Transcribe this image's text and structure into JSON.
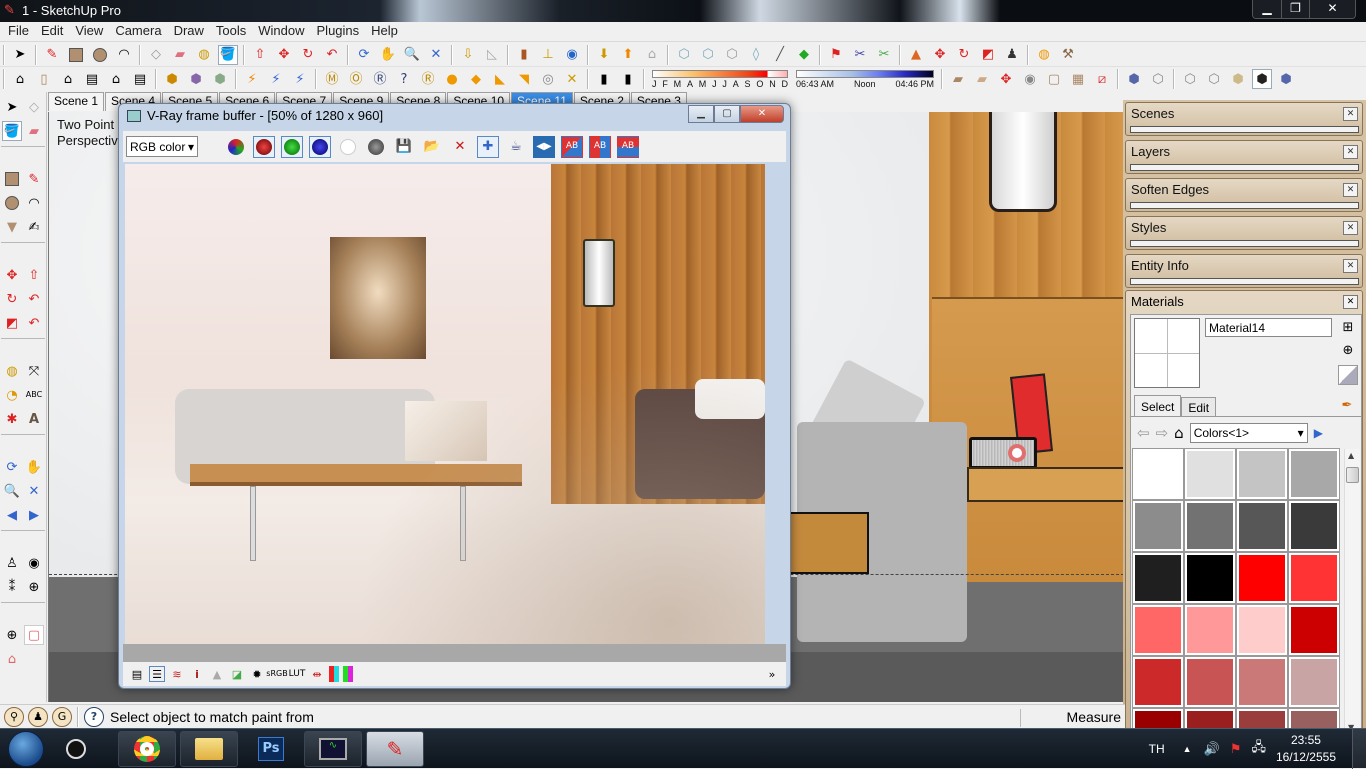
{
  "window": {
    "title": "1 - SketchUp Pro",
    "controls": [
      "minimize",
      "restore",
      "close"
    ]
  },
  "menu": [
    "File",
    "Edit",
    "View",
    "Camera",
    "Draw",
    "Tools",
    "Window",
    "Plugins",
    "Help"
  ],
  "toolbar1": {
    "icons": [
      "select-icon",
      "line-icon",
      "rectangle-icon",
      "circle-icon",
      "arc-icon",
      "make-component-icon",
      "eraser-icon",
      "tape-measure-icon",
      "paint-bucket-icon",
      "push-pull-icon",
      "move-icon",
      "rotate-icon",
      "follow-me-icon",
      "orbit-icon",
      "pan-icon",
      "zoom-icon",
      "zoom-extents-icon",
      "get-models-icon",
      "share-model-icon",
      "add-location-icon",
      "toggle-terrain-icon",
      "google-earth-icon",
      "get-photo-texture-icon",
      "share-component-icon",
      "component-icon",
      "xray-icon",
      "back-edges-icon",
      "wireframe-icon",
      "hidden-line-icon",
      "shaded-icon",
      "shaded-textures-icon",
      "sandbox-from-contours-icon",
      "sandbox-from-scratch-icon",
      "smoove-icon",
      "stamp-icon",
      "drape-icon",
      "add-detail-icon",
      "flip-edge-icon",
      "sun-icon",
      "tools-icon"
    ]
  },
  "toolbar2": {
    "icons": [
      "iso-view-icon",
      "top-view-icon",
      "front-view-icon",
      "right-view-icon",
      "back-view-icon",
      "left-view-icon",
      "outer-shell-icon",
      "intersect-icon",
      "union-icon",
      "section-plane-icon",
      "display-section-icon",
      "display-cuts-icon",
      "vray-material-editor-icon",
      "vray-options-icon",
      "vray-render-icon",
      "vray-help-icon",
      "vray-rt-icon",
      "omni-light-icon",
      "rect-light-icon",
      "spot-light-icon",
      "ies-light-icon",
      "dome-light-icon",
      "sphere-light-icon",
      "mesh-light-icon",
      "model-info-icon",
      "entity-info-icon"
    ],
    "shadow_months": [
      "J",
      "F",
      "M",
      "A",
      "M",
      "J",
      "J",
      "A",
      "S",
      "O",
      "N",
      "D"
    ],
    "shadow_month_value": "O",
    "shadow_times": [
      "06:43 AM",
      "Noon",
      "04:46 PM"
    ],
    "style_icons": [
      "xray-face-icon",
      "wire-face-icon",
      "hidden-line-face-icon",
      "shaded-face-icon",
      "texture-face-icon",
      "monochrome-face-icon",
      "section-face-icon",
      "back-edges-face-icon",
      "face-style-icon"
    ]
  },
  "left_toolbar": [
    "select-icon",
    "make-component-icon",
    "paint-bucket-icon",
    "eraser-icon",
    "rectangle-icon",
    "line-icon",
    "circle-icon",
    "arc-icon",
    "polygon-icon",
    "freehand-icon",
    "move-icon",
    "push-pull-icon",
    "rotate-icon",
    "follow-me-icon",
    "scale-icon",
    "offset-icon",
    "tape-measure-icon",
    "dimension-icon",
    "protractor-icon",
    "text-icon",
    "axes-icon",
    "3d-text-icon",
    "orbit-icon",
    "pan-icon",
    "zoom-icon",
    "zoom-window-icon",
    "previous-view-icon",
    "next-view-icon",
    "position-camera-icon",
    "look-around-icon",
    "walk-icon",
    "section-plane-icon",
    "section-view-icon",
    "advanced-camera-icon",
    "house-icon"
  ],
  "scene_tabs": [
    {
      "label": "Scene 1",
      "active": false
    },
    {
      "label": "Scene 4",
      "active": false
    },
    {
      "label": "Scene 5",
      "active": false
    },
    {
      "label": "Scene 6",
      "active": false
    },
    {
      "label": "Scene 7",
      "active": false
    },
    {
      "label": "Scene 9",
      "active": false
    },
    {
      "label": "Scene 8",
      "active": false
    },
    {
      "label": "Scene 10",
      "active": false
    },
    {
      "label": "Scene 11",
      "active": true
    },
    {
      "label": "Scene 2",
      "active": false
    },
    {
      "label": "Scene 3",
      "active": false
    }
  ],
  "viewport": {
    "camera_label_line1": "Two Point",
    "camera_label_line2": "Perspective"
  },
  "vray_window": {
    "title": "V-Ray frame buffer - [50% of 1280 x 960]",
    "channel_select": "RGB color",
    "toolbar_icons": [
      "rgb-channel-icon",
      "red-channel-icon",
      "green-channel-icon",
      "blue-channel-icon",
      "alpha-channel-icon",
      "mono-channel-icon",
      "save-image-icon",
      "load-image-icon",
      "clear-image-icon",
      "track-mouse-icon",
      "render-last-icon",
      "compare-horizontal-icon",
      "ab-diagonal-icon",
      "ab-horizontal-icon",
      "ab-vertical-icon"
    ],
    "bottom_icons": [
      "display-window-icon",
      "color-corrections-icon",
      "pixel-info-icon",
      "info-icon",
      "histogram-icon",
      "curves-icon",
      "exposure-icon",
      "srgb-icon",
      "lut-icon",
      "compare-icon",
      "red-cyan-icon",
      "green-magenta-icon"
    ],
    "bottom_labels": {
      "srgb": "sRGB",
      "lut": "LUT",
      "info": "i"
    }
  },
  "trays": [
    {
      "label": "Scenes"
    },
    {
      "label": "Layers"
    },
    {
      "label": "Soften Edges"
    },
    {
      "label": "Styles"
    },
    {
      "label": "Entity Info"
    }
  ],
  "materials": {
    "title": "Materials",
    "name_value": "Material14",
    "tabs": [
      {
        "label": "Select",
        "active": true
      },
      {
        "label": "Edit",
        "active": false
      }
    ],
    "library": "Colors<1>",
    "swatches": [
      "#ffffff",
      "#e0e0e0",
      "#c4c4c4",
      "#a8a8a8",
      "#8c8c8c",
      "#727272",
      "#575757",
      "#3a3a3a",
      "#1f1f1f",
      "#000000",
      "#ff0000",
      "#ff3333",
      "#ff6666",
      "#ff9999",
      "#ffcccc",
      "#cc0000",
      "#cc2a2a",
      "#c85454",
      "#ca7878",
      "#c9a4a4",
      "#990000",
      "#9a2020",
      "#993d3d",
      "#996060"
    ]
  },
  "status": {
    "message": "Select object to match paint from",
    "measure_label": "Measure"
  },
  "taskbar": {
    "apps": [
      "chrome",
      "file-explorer",
      "photoshop",
      "resource-monitor",
      "sketchup"
    ],
    "photoshop_label": "Ps",
    "language": "TH",
    "time": "23:55",
    "date": "16/12/2555"
  }
}
